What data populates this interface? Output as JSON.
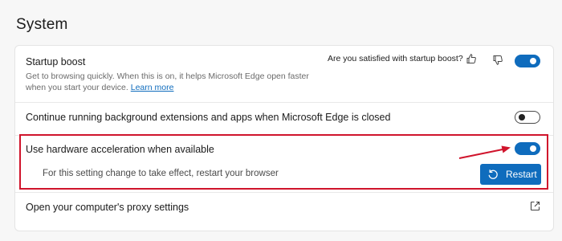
{
  "section": {
    "title": "System"
  },
  "settings": {
    "startup_boost": {
      "title": "Startup boost",
      "description": "Get to browsing quickly. When this is on, it helps Microsoft Edge open faster when you start your device.",
      "learn_more": "Learn more",
      "feedback_question": "Are you satisfied with startup boost?",
      "toggle_state": "on"
    },
    "background_extensions": {
      "title": "Continue running background extensions and apps when Microsoft Edge is closed",
      "toggle_state": "off"
    },
    "hardware_acceleration": {
      "title": "Use hardware acceleration when available",
      "restart_notice": "For this setting change to take effect, restart your browser",
      "restart_button": "Restart",
      "toggle_state": "on"
    },
    "proxy": {
      "title": "Open your computer's proxy settings"
    }
  },
  "annotation": {
    "color": "#d0142c"
  },
  "colors": {
    "accent": "#0f6cbd"
  },
  "icons": [
    "thumbs-up-icon",
    "thumbs-down-icon",
    "restart-icon",
    "external-link-icon"
  ]
}
